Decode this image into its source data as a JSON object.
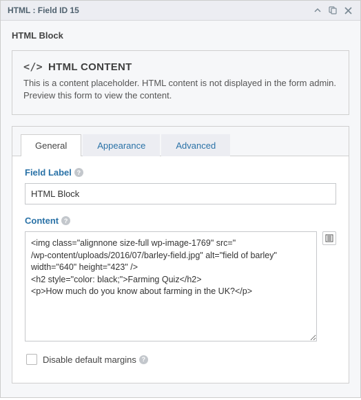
{
  "header": {
    "title": "HTML : Field ID 15"
  },
  "blockName": "HTML Block",
  "placeholder": {
    "title": "HTML CONTENT",
    "desc": "This is a content placeholder. HTML content is not displayed in the form admin. Preview this form to view the content."
  },
  "tabs": {
    "general": "General",
    "appearance": "Appearance",
    "advanced": "Advanced"
  },
  "fields": {
    "fieldLabel": {
      "label": "Field Label",
      "value": "HTML Block"
    },
    "content": {
      "label": "Content",
      "value": "<img class=\"alignnone size-full wp-image-1769\" src=\"                                            /wp-content/uploads/2016/07/barley-field.jpg\" alt=\"field of barley\" width=\"640\" height=\"423\" />\n<h2 style=\"color: black;\">Farming Quiz</h2>\n<p>How much do you know about farming in the UK?</p>"
    },
    "disableMargins": {
      "label": "Disable default margins",
      "checked": false
    }
  }
}
